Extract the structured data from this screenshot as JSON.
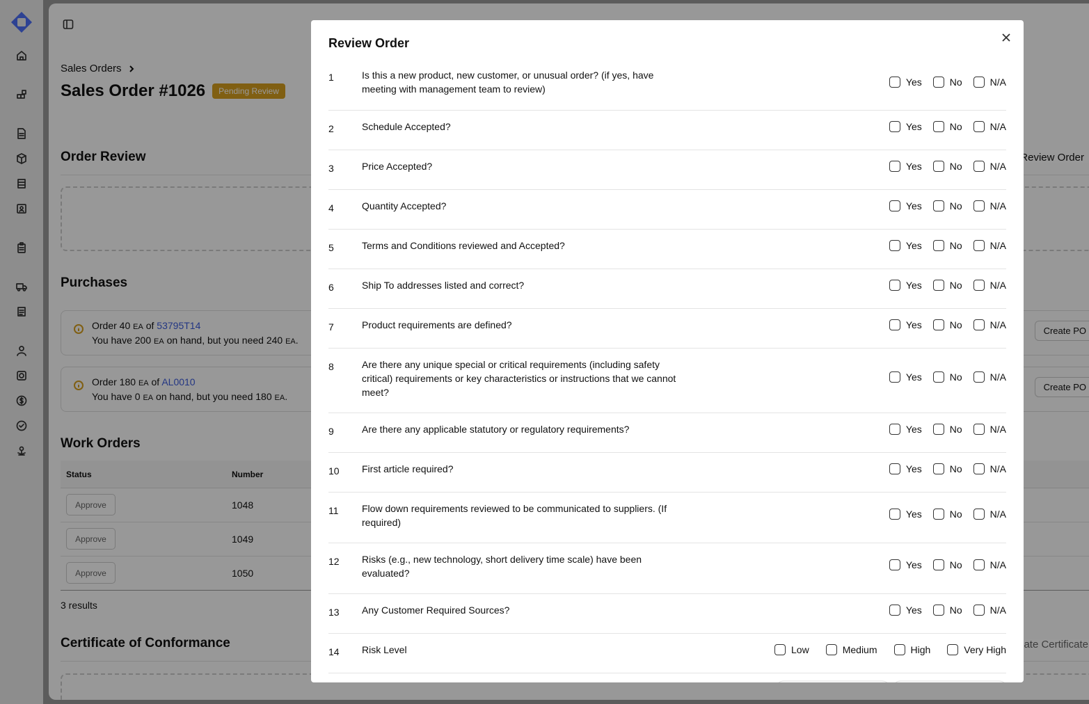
{
  "header": {
    "breadcrumb": "Sales Orders",
    "title": "Sales Order #1026",
    "status_badge": "Pending Review"
  },
  "sections": {
    "order_review": "Order Review",
    "review_order_button": "Review Order",
    "purchases": "Purchases",
    "work_orders": "Work Orders",
    "certificate": "Certificate of Conformance",
    "create_certificate_button": "ate Certificate"
  },
  "purchases": [
    {
      "order_qty": "Order 40",
      "unit": "EA",
      "of": "of",
      "part": "53795T14",
      "have": "You have 200",
      "have_unit": "EA",
      "need": "on hand, but you need 240",
      "need_unit": "EA",
      "button": "Create PO"
    },
    {
      "order_qty": "Order 180",
      "unit": "EA",
      "of": "of",
      "part": "AL0010",
      "have": "You have 0",
      "have_unit": "EA",
      "need": "on hand, but you need 180",
      "need_unit": "EA",
      "button": "Create PO"
    }
  ],
  "work_orders": {
    "columns": [
      "Status",
      "Number"
    ],
    "rows": [
      {
        "action": "Approve",
        "number": "1048"
      },
      {
        "action": "Approve",
        "number": "1049"
      },
      {
        "action": "Approve",
        "number": "1050"
      }
    ],
    "results": "3 results"
  },
  "modal": {
    "title": "Review Order",
    "questions": [
      {
        "num": "1",
        "text": "Is this a new product, new customer, or unusual order? (if yes, have meeting with management team to review)",
        "options": [
          "Yes",
          "No",
          "N/A"
        ]
      },
      {
        "num": "2",
        "text": "Schedule Accepted?",
        "options": [
          "Yes",
          "No",
          "N/A"
        ]
      },
      {
        "num": "3",
        "text": "Price Accepted?",
        "options": [
          "Yes",
          "No",
          "N/A"
        ]
      },
      {
        "num": "4",
        "text": "Quantity Accepted?",
        "options": [
          "Yes",
          "No",
          "N/A"
        ]
      },
      {
        "num": "5",
        "text": "Terms and Conditions reviewed and Accepted?",
        "options": [
          "Yes",
          "No",
          "N/A"
        ]
      },
      {
        "num": "6",
        "text": "Ship To addresses listed and correct?",
        "options": [
          "Yes",
          "No",
          "N/A"
        ]
      },
      {
        "num": "7",
        "text": "Product requirements are defined?",
        "options": [
          "Yes",
          "No",
          "N/A"
        ]
      },
      {
        "num": "8",
        "text": "Are there any unique special or critical requirements (including safety critical) requirements or key characteristics or instructions that we cannot meet?",
        "options": [
          "Yes",
          "No",
          "N/A"
        ]
      },
      {
        "num": "9",
        "text": "Are there any applicable statutory or regulatory requirements?",
        "options": [
          "Yes",
          "No",
          "N/A"
        ]
      },
      {
        "num": "10",
        "text": "First article required?",
        "options": [
          "Yes",
          "No",
          "N/A"
        ]
      },
      {
        "num": "11",
        "text": "Flow down requirements reviewed to be communicated to suppliers. (If required)",
        "options": [
          "Yes",
          "No",
          "N/A"
        ]
      },
      {
        "num": "12",
        "text": "Risks (e.g., new technology, short delivery time scale) have been evaluated?",
        "options": [
          "Yes",
          "No",
          "N/A"
        ]
      },
      {
        "num": "13",
        "text": "Any Customer Required Sources?",
        "options": [
          "Yes",
          "No",
          "N/A"
        ]
      },
      {
        "num": "14",
        "text": "Risk Level",
        "options": [
          "Low",
          "Medium",
          "High",
          "Very High"
        ]
      }
    ]
  },
  "colors": {
    "accent": "#d69e1f",
    "link": "#3b5bdb"
  }
}
